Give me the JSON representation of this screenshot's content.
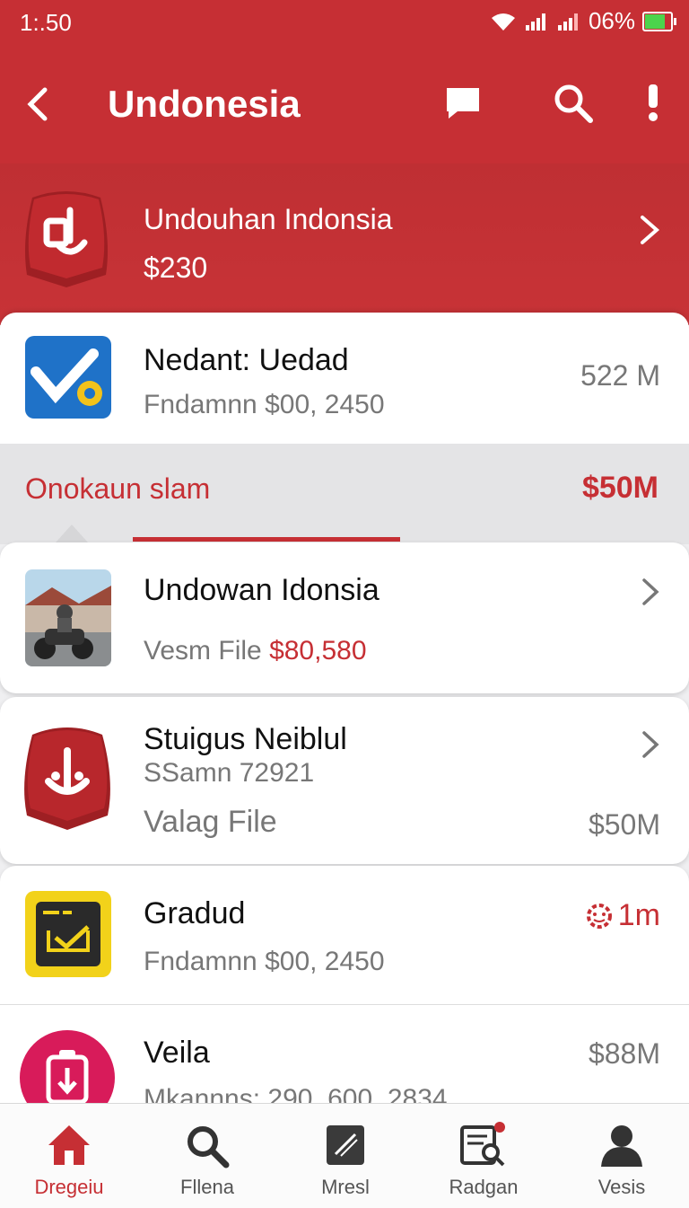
{
  "status_bar": {
    "time": "1:.50",
    "battery": "06%"
  },
  "app_bar": {
    "title": "Undonesia"
  },
  "featured": {
    "title": "Undouhan Indonsia",
    "price": "$230"
  },
  "items": [
    {
      "title": "Nedant: Uedad",
      "subtitle": "Fndamnn $00, 2450",
      "right": "522 M"
    },
    {
      "title": "Undowan Idonsia",
      "subtitle_prefix": "Vesm File",
      "subtitle_value": "$80,580"
    },
    {
      "title": "Stuigus Neiblul",
      "subtitle": "SSamn 72921",
      "detail": "Valag File",
      "right": "$50M"
    },
    {
      "title": "Gradud",
      "subtitle": "Fndamnn $00, 2450",
      "right": "1m"
    },
    {
      "title": "Veila",
      "subtitle": "Mkannns: 290. 600. 2834",
      "right": "$88M"
    }
  ],
  "section": {
    "label": "Onokaun slam",
    "amount": "$50M"
  },
  "bottom_nav": [
    {
      "label": "Dregeiu",
      "icon": "home-icon",
      "active": true
    },
    {
      "label": "Fllena",
      "icon": "search-icon"
    },
    {
      "label": "Mresl",
      "icon": "edit-icon"
    },
    {
      "label": "Radgan",
      "icon": "document-search-icon"
    },
    {
      "label": "Vesis",
      "icon": "person-icon"
    }
  ],
  "colors": {
    "primary": "#c62f34",
    "accent_red": "#c62f34",
    "gray_text": "#777777"
  }
}
